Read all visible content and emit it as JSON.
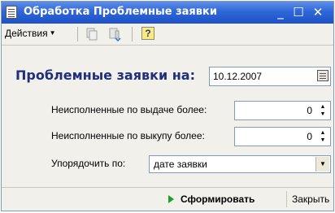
{
  "window": {
    "title": "Обработка  Проблемные заявки",
    "minimize": "_",
    "maximize": "☐",
    "close": "✕"
  },
  "toolbar": {
    "actions_label": "Действия",
    "actions_arrow": "▼",
    "help": "?"
  },
  "form": {
    "heading": "Проблемные заявки на:",
    "date_value": "10.12.2007",
    "unfulfilled_issue_label": "Неисполненные по выдаче более:",
    "unfulfilled_issue_value": "0",
    "unfulfilled_buyout_label": "Неисполненные по выкупу более:",
    "unfulfilled_buyout_value": "0",
    "sort_label": "Упорядочить по:",
    "sort_value": "дате заявки",
    "spin_up": "▲",
    "spin_down": "▼",
    "dropdown_arrow": "▼"
  },
  "footer": {
    "generate_label": "Сформировать",
    "close_label": "Закрыть"
  }
}
